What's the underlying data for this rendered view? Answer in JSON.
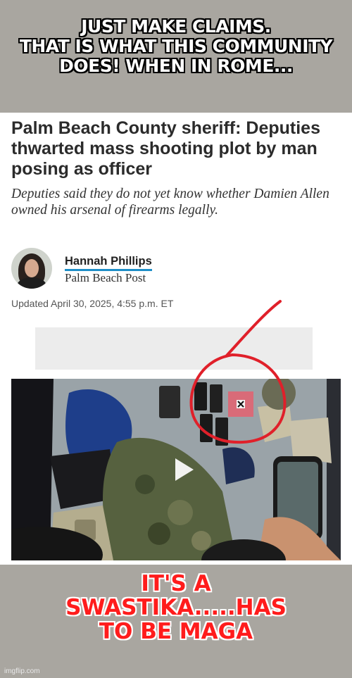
{
  "meme": {
    "top_text_lines": [
      "JUST MAKE CLAIMS.",
      "THAT IS WHAT THIS COMMUNITY",
      "DOES!  WHEN IN ROME..."
    ],
    "bottom_text_lines": [
      "IT'S A",
      "SWASTIKA.....HAS",
      "TO BE MAGA"
    ],
    "watermark": "imgflip.com"
  },
  "article": {
    "headline": "Palm Beach County sheriff: Deputies thwarted mass shooting plot by man posing as officer",
    "dek": "Deputies said they do not yet know whether Damien Allen owned his arsenal of firearms legally.",
    "author_name": "Hannah Phillips",
    "author_org": "Palm Beach Post",
    "updated": "Updated April 30, 2025, 4:55 p.m. ET"
  },
  "colors": {
    "background": "#a9a6a0",
    "top_text": "#ffffff",
    "bottom_text": "#ff1c1c",
    "annotation_circle": "#e0202a",
    "author_underline": "#1d8ec8"
  },
  "icons": {
    "play": "play-icon",
    "circle": "red-hand-drawn-circle"
  }
}
